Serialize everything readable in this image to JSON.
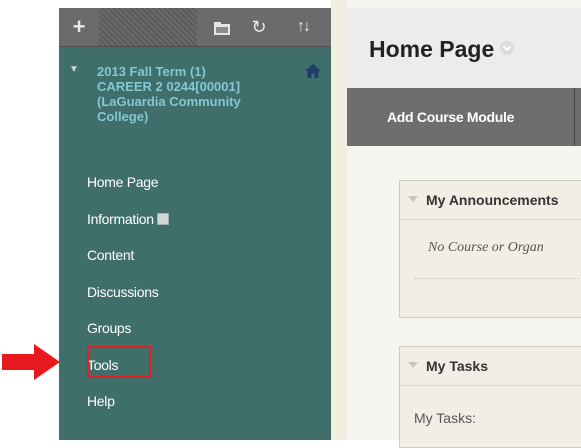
{
  "toolbar": {
    "plus": "+",
    "folder_icon": "folder-icon",
    "refresh": "↻",
    "sort": "↑↓"
  },
  "course": {
    "title_lines": [
      "2013 Fall Term (1)",
      "CAREER 2 0244[00001]",
      "(LaGuardia Community",
      "College)"
    ]
  },
  "menu": {
    "items": [
      {
        "label": "Home Page"
      },
      {
        "label": "Information"
      },
      {
        "label": "Content"
      },
      {
        "label": "Discussions"
      },
      {
        "label": "Groups"
      },
      {
        "label": "Tools"
      },
      {
        "label": "Help"
      }
    ]
  },
  "main": {
    "page_title": "Home Page",
    "add_module_label": "Add Course Module",
    "modules": [
      {
        "title": "My Announcements",
        "body": "No Course or Organ"
      },
      {
        "title": "My Tasks",
        "body": "My Tasks:"
      }
    ]
  },
  "colors": {
    "sidebar_bg": "#3f6e6b",
    "course_title": "#83c8d3",
    "highlight": "#e02020",
    "arrow": "#e8191e"
  }
}
